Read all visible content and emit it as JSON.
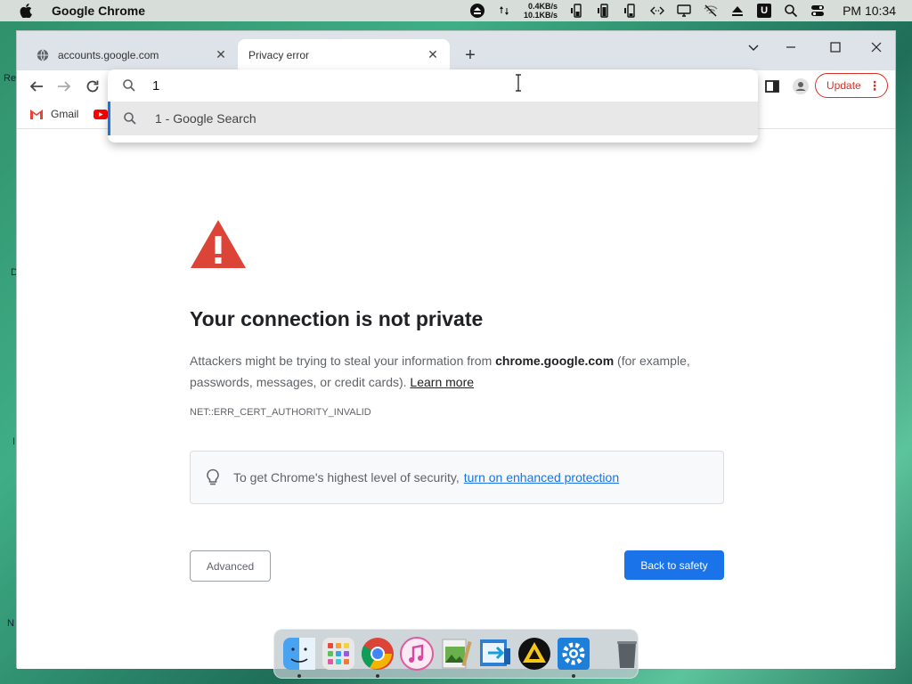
{
  "menubar": {
    "app_name": "Google Chrome",
    "net_up": "0.4KB/s",
    "net_down": "10.1KB/s",
    "u_label": "U",
    "clock": "PM 10:34"
  },
  "desktop": {
    "label_re": "Re",
    "label_d": "D",
    "label_i": "I",
    "label_n": "N"
  },
  "tabs": [
    {
      "label": "accounts.google.com",
      "favicon": "globe-icon",
      "active": false
    },
    {
      "label": "Privacy error",
      "favicon": "",
      "active": true
    }
  ],
  "toolbar": {
    "update_label": "Update"
  },
  "bookmarks": [
    {
      "label": "Gmail",
      "icon": "gmail-icon"
    },
    {
      "label": "",
      "icon": "youtube-icon"
    }
  ],
  "omnibox": {
    "value": "1",
    "suggestion": "1 - Google Search"
  },
  "page": {
    "heading": "Your connection is not private",
    "para_pre": "Attackers might be trying to steal your information from ",
    "para_domain": "chrome.google.com",
    "para_post": " (for example, passwords, messages, or credit cards). ",
    "learn_more": "Learn more",
    "error_code": "NET::ERR_CERT_AUTHORITY_INVALID",
    "info_text": "To get Chrome's highest level of security,",
    "info_link": "turn on enhanced protection",
    "advanced_label": "Advanced",
    "back_label": "Back to safety"
  },
  "colors": {
    "accent_blue": "#1a73e8",
    "warning_red": "#db4437",
    "update_red": "#d93025"
  },
  "dock": [
    "finder-icon",
    "launchpad-icon",
    "chrome-icon",
    "itunes-icon",
    "photo-preview-icon",
    "migration-icon",
    "vlc-icon",
    "settings-icon",
    "trash-icon"
  ]
}
